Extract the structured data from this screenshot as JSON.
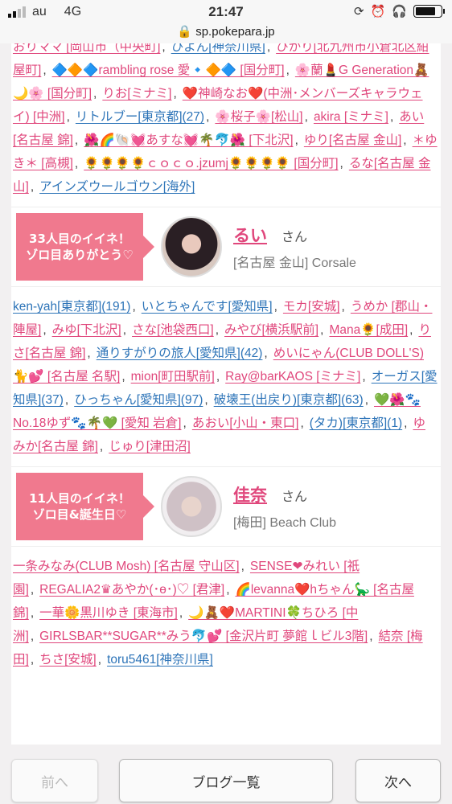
{
  "status_bar": {
    "carrier": "au",
    "network": "4G",
    "time": "21:47"
  },
  "url_bar": {
    "url": "sp.pokepara.jp"
  },
  "list1": [
    {
      "text": "おりママ [岡山市（中央町]",
      "color": "pink"
    },
    {
      "text": "ひよん[神奈川県]",
      "color": "blue"
    },
    {
      "text": "ひかり[北九州市小倉北区紺屋町]",
      "color": "pink"
    },
    {
      "text": "🔷🔶🔷rambling rose 愛🔹🔶🔷 [国分町]",
      "color": "pink"
    },
    {
      "text": "🌸蘭💄G Generation🧸🌙🌸 [国分町]",
      "color": "pink"
    },
    {
      "text": "りお[ミナミ]",
      "color": "pink"
    },
    {
      "text": "❤️神崎なお❤️(中洲･メンバーズキャラウェイ) [中洲]",
      "color": "pink"
    },
    {
      "text": "リトルブー[東京都](27)",
      "color": "blue"
    },
    {
      "text": "🌸桜子🌸[松山]",
      "color": "pink"
    },
    {
      "text": "akira [ミナミ]",
      "color": "pink"
    },
    {
      "text": "あい[名古屋 錦]",
      "color": "pink"
    },
    {
      "text": "🌺🌈🐚💓あすな💓🌴🐬🌺 [下北沢]",
      "color": "pink"
    },
    {
      "text": "ゆり[名古屋 金山]",
      "color": "pink"
    },
    {
      "text": "＊ゆき＊ [高槻]",
      "color": "pink"
    },
    {
      "text": "🌻🌻🌻🌻ｃｏｃｏ.jzumj🌻🌻🌻🌻 [国分町]",
      "color": "pink"
    },
    {
      "text": "るな[名古屋 金山]",
      "color": "pink"
    },
    {
      "text": "アインズウールゴウン[海外]",
      "color": "blue"
    }
  ],
  "card1": {
    "ribbon": "33人目のイイネ！\nゾロ目ありがとう♡",
    "name": "るい",
    "honorific": "さん",
    "location": "[名古屋 金山] Corsale"
  },
  "list2": [
    {
      "text": "ken-yah[東京都](191)",
      "color": "blue"
    },
    {
      "text": "いとちゃんです[愛知県]",
      "color": "blue"
    },
    {
      "text": "モカ[安城]",
      "color": "pink"
    },
    {
      "text": "うめか [郡山・陣屋]",
      "color": "pink"
    },
    {
      "text": "みゆ[下北沢]",
      "color": "pink"
    },
    {
      "text": "さな[池袋西口]",
      "color": "pink"
    },
    {
      "text": "みやび[横浜駅前]",
      "color": "pink"
    },
    {
      "text": "Mana🌻[成田]",
      "color": "pink"
    },
    {
      "text": "りさ[名古屋 錦]",
      "color": "pink"
    },
    {
      "text": "通りすがりの旅人[愛知県](42)",
      "color": "blue"
    },
    {
      "text": "めいにゃん(CLUB DOLL'S)🐈💕 [名古屋 名駅]",
      "color": "pink"
    },
    {
      "text": "mion[町田駅前]",
      "color": "pink"
    },
    {
      "text": "Ray@barKAOS [ミナミ]",
      "color": "pink"
    },
    {
      "text": "オーガス[愛知県](37)",
      "color": "blue"
    },
    {
      "text": "ひっちゃん[愛知県](97)",
      "color": "blue"
    },
    {
      "text": "破壊王(出戻り)[東京都](63)",
      "color": "blue"
    },
    {
      "text": "💚🌺🐾No.18ゆず🐾🌴💚 [愛知 岩倉]",
      "color": "pink"
    },
    {
      "text": "あおい[小山・東口]",
      "color": "pink"
    },
    {
      "text": "(タカ)[東京都](1)",
      "color": "blue"
    },
    {
      "text": "ゆみか[名古屋 錦]",
      "color": "pink"
    },
    {
      "text": "じゅり[津田沼]",
      "color": "pink"
    }
  ],
  "card2": {
    "ribbon": "11人目のイイネ！\nゾロ目&誕生日♡",
    "name": "佳奈",
    "honorific": "さん",
    "location": "[梅田] Beach Club"
  },
  "list3": [
    {
      "text": "一条みなみ(CLUB Mosh) [名古屋 守山区]",
      "color": "pink"
    },
    {
      "text": "SENSE❤みれい [祇園]",
      "color": "pink"
    },
    {
      "text": "REGALIA2♛あやか(･ө･)♡ [君津]",
      "color": "pink"
    },
    {
      "text": "🌈levanna❤️hちゃん🦕 [名古屋 錦]",
      "color": "pink"
    },
    {
      "text": "一華🌼黒川ゆき [東海市]",
      "color": "pink"
    },
    {
      "text": "🌙🧸❤️MARTINI🍀ちひろ [中洲]",
      "color": "pink"
    },
    {
      "text": "GIRLSBAR**SUGAR**みう🐬💕 [金沢片町 夢館ｌビル3階]",
      "color": "pink"
    },
    {
      "text": "結奈 [梅田]",
      "color": "pink"
    },
    {
      "text": "ちさ[安城]",
      "color": "pink"
    },
    {
      "text": "toru5461[神奈川県]",
      "color": "blue"
    }
  ],
  "nav": {
    "prev": "前へ",
    "blog_list": "ブログ一覧",
    "next": "次へ"
  }
}
